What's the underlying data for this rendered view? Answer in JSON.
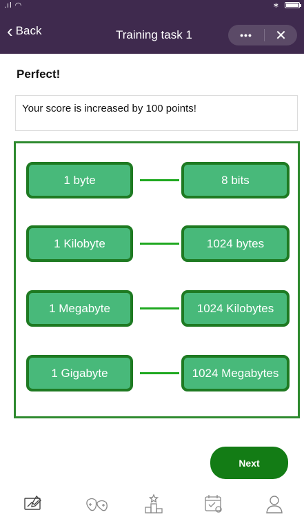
{
  "status_bar": {
    "signal_icon": "signal-wifi-icon",
    "bluetooth_icon": "bluetooth-icon",
    "battery_icon": "battery-icon"
  },
  "nav": {
    "back_label": "Back",
    "title": "Training task 1",
    "more_label": "•••",
    "close_label": "✕"
  },
  "feedback": {
    "title": "Perfect!",
    "message": "Your score is increased by 100 points!"
  },
  "matches": [
    {
      "left": "1 byte",
      "right": "8 bits"
    },
    {
      "left": "1 Kilobyte",
      "right": "1024 bytes"
    },
    {
      "left": "1 Megabyte",
      "right": "1024 Kilobytes"
    },
    {
      "left": "1 Gigabyte",
      "right": "1024 Megabytes"
    }
  ],
  "next_label": "Next",
  "tabs": [
    {
      "icon": "learning-icon"
    },
    {
      "icon": "games-icon"
    },
    {
      "icon": "leaderboard-icon"
    },
    {
      "icon": "calendar-icon"
    },
    {
      "icon": "profile-icon"
    }
  ],
  "colors": {
    "header": "#3f2a4e",
    "tile_fill": "#48b97a",
    "tile_border": "#1e7a22",
    "panel_border": "#2e8a2f",
    "next_button": "#137c15"
  }
}
